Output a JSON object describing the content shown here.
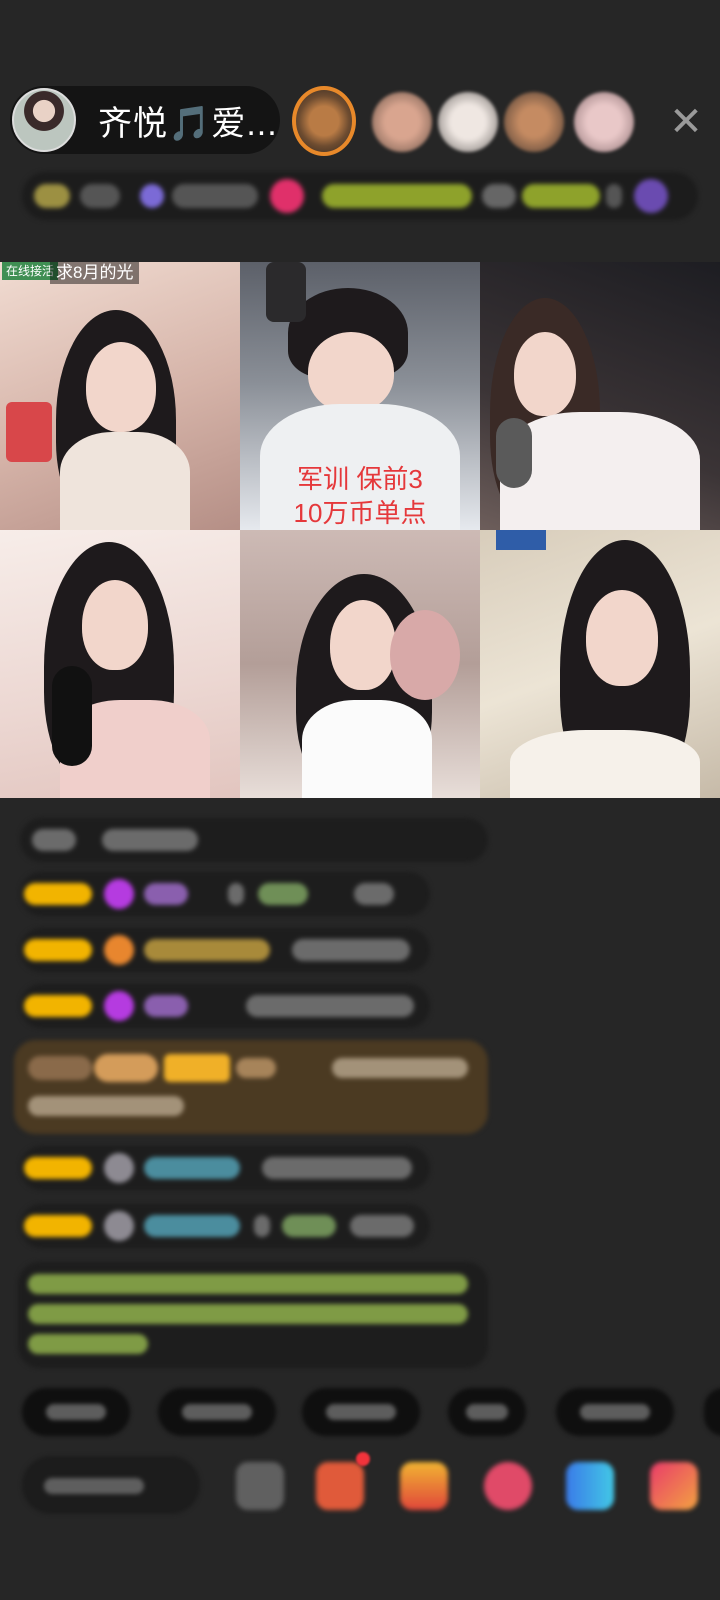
{
  "header": {
    "host_name": "齐悦🎵爱...",
    "close_icon": "close-icon"
  },
  "grid": {
    "tag_online": "在线接活",
    "stream_title": "求8月的光",
    "overlay_text": "军训 保前3\n10万币单点"
  },
  "colors": {
    "background": "#262626",
    "overlay_red": "#e5383b",
    "online_tag": "#3f8f53",
    "aud1_ring": "#e8892a"
  },
  "icons": [
    "close-icon",
    "gift-box-icon",
    "red-packet-icon",
    "heart-icon",
    "game-icon",
    "more-icon"
  ]
}
